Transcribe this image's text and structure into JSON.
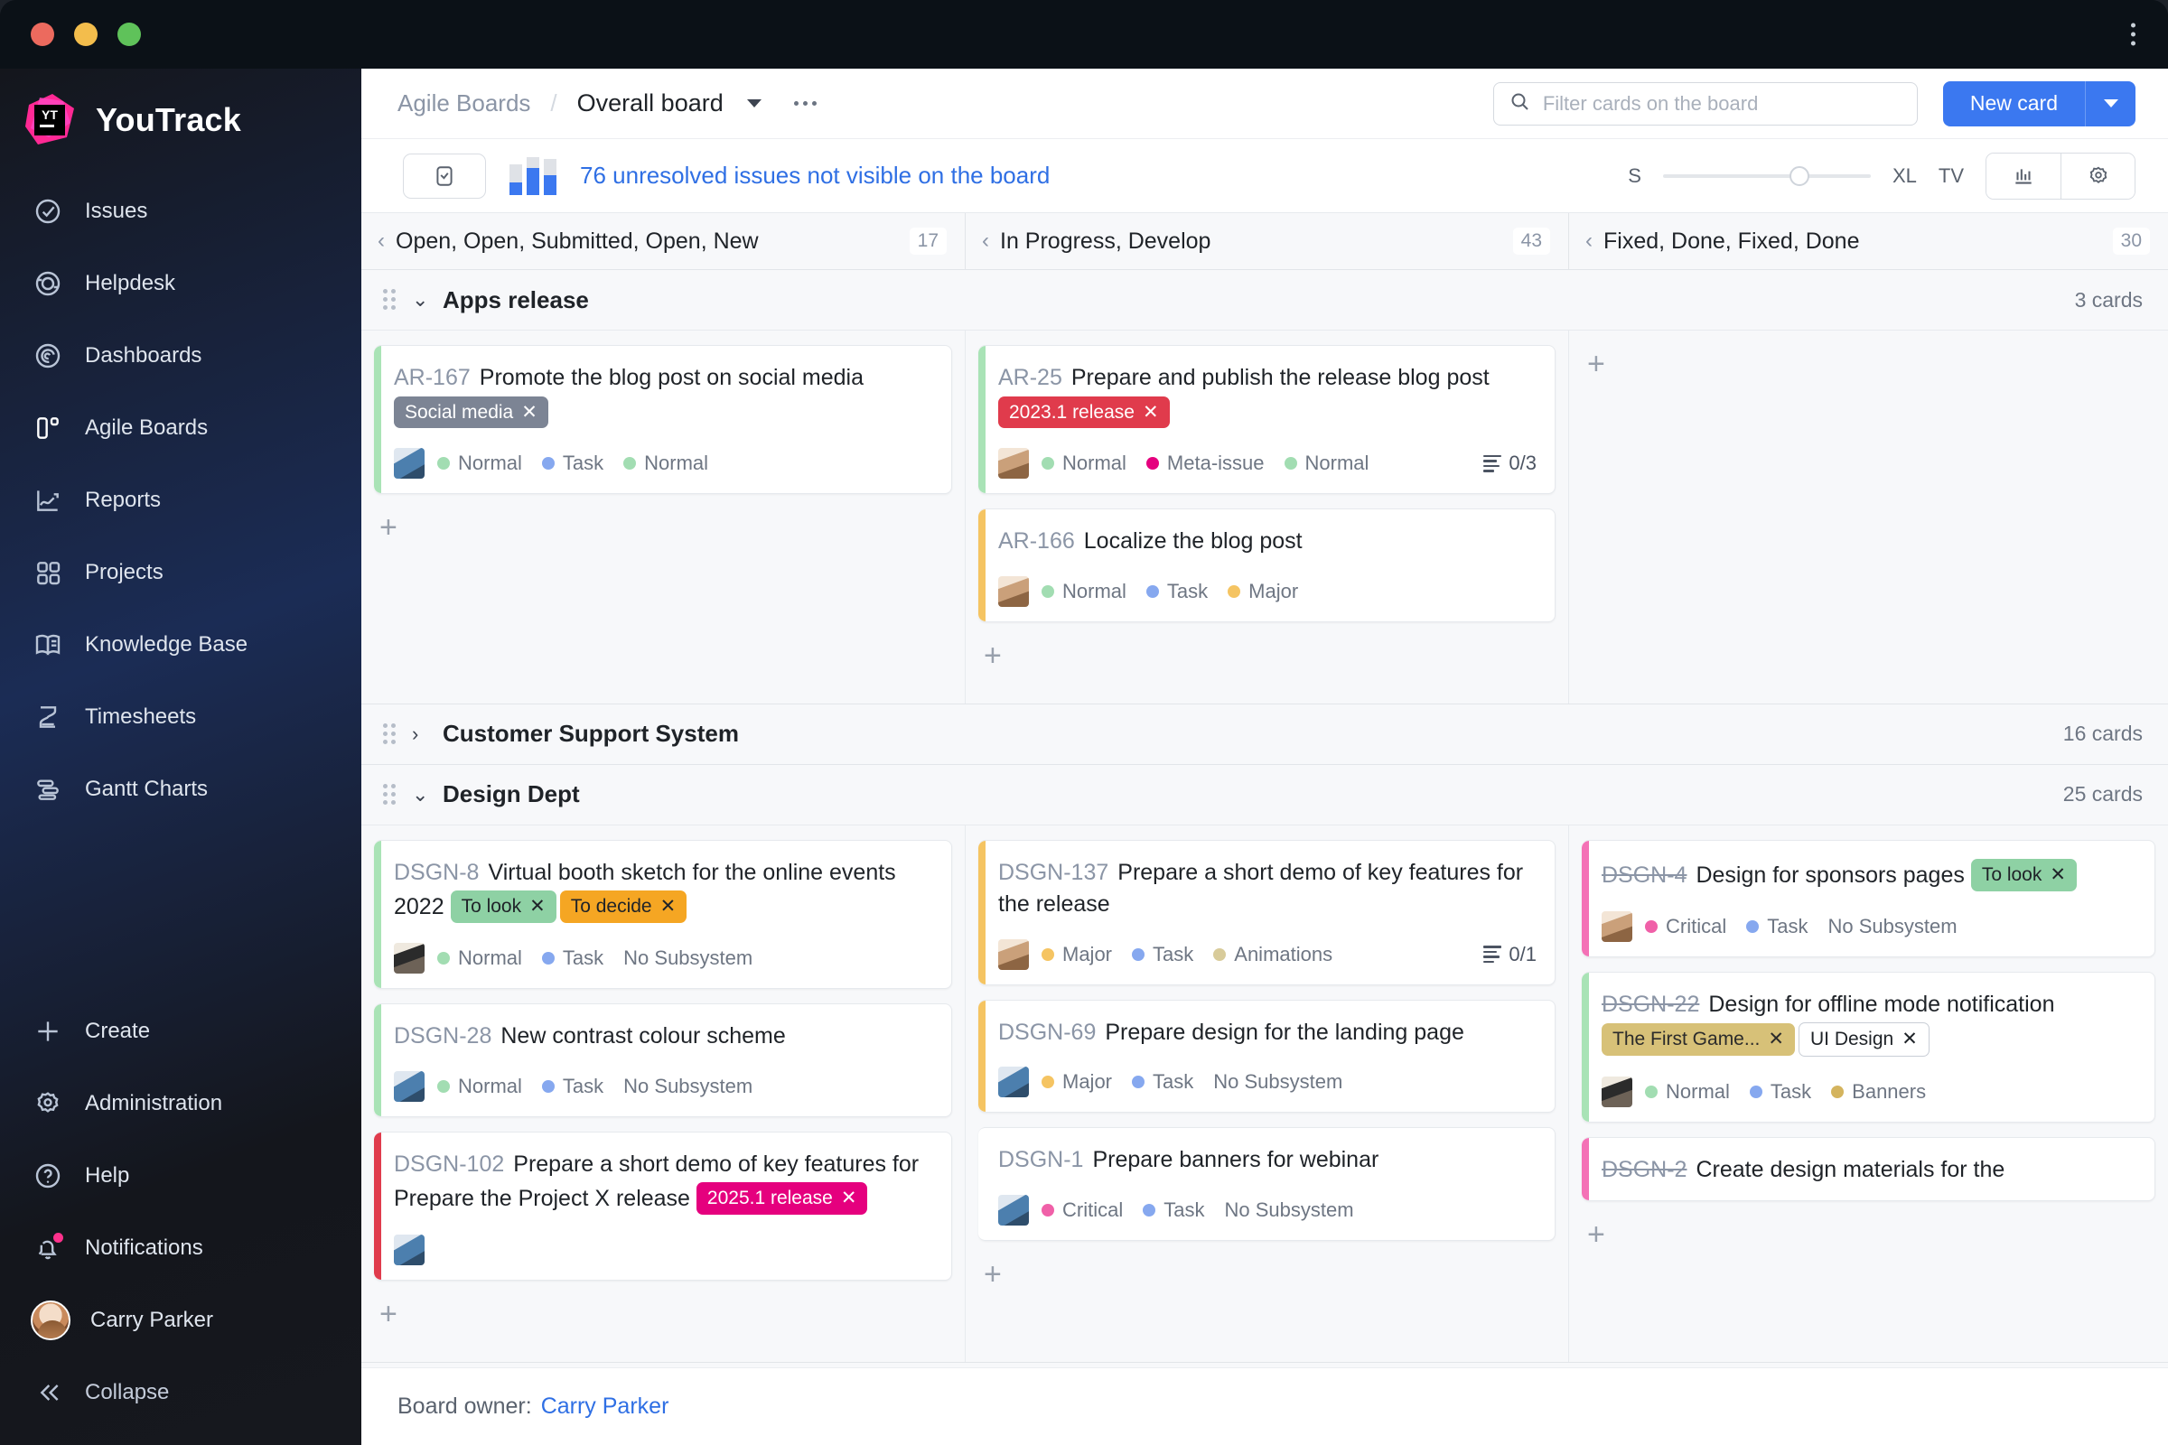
{
  "window": {
    "title": "YouTrack"
  },
  "sidebar": {
    "brand": "YouTrack",
    "items": [
      {
        "label": "Issues",
        "icon": "check-circle-icon"
      },
      {
        "label": "Helpdesk",
        "icon": "headset-icon"
      },
      {
        "label": "Dashboards",
        "icon": "spiral-icon"
      },
      {
        "label": "Agile Boards",
        "icon": "board-icon"
      },
      {
        "label": "Reports",
        "icon": "trend-up-icon"
      },
      {
        "label": "Projects",
        "icon": "grid-icon"
      },
      {
        "label": "Knowledge Base",
        "icon": "book-icon"
      },
      {
        "label": "Timesheets",
        "icon": "hourglass-icon"
      },
      {
        "label": "Gantt Charts",
        "icon": "gantt-icon"
      }
    ],
    "bottom": [
      {
        "label": "Create",
        "icon": "plus-icon"
      },
      {
        "label": "Administration",
        "icon": "gear-icon"
      },
      {
        "label": "Help",
        "icon": "question-circle-icon"
      },
      {
        "label": "Notifications",
        "icon": "bell-icon"
      }
    ],
    "user": "Carry Parker",
    "collapse": "Collapse"
  },
  "topbar": {
    "breadcrumb_root": "Agile Boards",
    "breadcrumb_separator": "/",
    "board_name": "Overall board",
    "search_placeholder": "Filter cards on the board",
    "search_value": "",
    "new_card_label": "New card"
  },
  "subbar": {
    "unresolved_text": "76 unresolved issues not visible on the board",
    "size_min": "S",
    "size_max": "XL",
    "tv_label": "TV"
  },
  "columns": [
    {
      "title": "Open, Open, Submitted, Open, New",
      "count": "17"
    },
    {
      "title": "In Progress, Develop",
      "count": "43"
    },
    {
      "title": "Fixed, Done, Fixed, Done",
      "count": "30"
    }
  ],
  "swimlanes": [
    {
      "title": "Apps release",
      "count": "3 cards",
      "expanded": true,
      "cells": [
        {
          "cards": [
            {
              "id": "AR-167",
              "resolved": false,
              "title": "Promote the blog post on social media",
              "stripe": "#a9e3b6",
              "tags": [
                {
                  "label": "Social media",
                  "bg": "#7c8494",
                  "fg": "#ffffff"
                }
              ],
              "avatar": "av-a",
              "chips": [
                {
                  "label": "Normal",
                  "color": "#a2ddb2"
                },
                {
                  "label": "Task",
                  "color": "#86a8ef"
                },
                {
                  "label": "Normal",
                  "color": "#a2ddb2"
                }
              ],
              "subtasks": ""
            }
          ]
        },
        {
          "cards": [
            {
              "id": "AR-25",
              "resolved": false,
              "title": "Prepare and publish the release blog post",
              "stripe": "#a9e3b6",
              "tags": [
                {
                  "label": "2023.1 release",
                  "bg": "#e03b4c",
                  "fg": "#ffffff"
                }
              ],
              "avatar": "av-b",
              "chips": [
                {
                  "label": "Normal",
                  "color": "#a2ddb2"
                },
                {
                  "label": "Meta-issue",
                  "color": "#e5007e"
                },
                {
                  "label": "Normal",
                  "color": "#a2ddb2"
                }
              ],
              "subtasks": "0/3"
            },
            {
              "id": "AR-166",
              "resolved": false,
              "title": "Localize the blog post",
              "stripe": "#f5c462",
              "tags": [],
              "avatar": "av-b",
              "chips": [
                {
                  "label": "Normal",
                  "color": "#a2ddb2"
                },
                {
                  "label": "Task",
                  "color": "#86a8ef"
                },
                {
                  "label": "Major",
                  "color": "#f5c462"
                }
              ],
              "subtasks": ""
            }
          ]
        },
        {
          "cards": []
        }
      ]
    },
    {
      "title": "Customer Support System",
      "count": "16 cards",
      "expanded": false,
      "cells": []
    },
    {
      "title": "Design Dept",
      "count": "25 cards",
      "expanded": true,
      "cells": [
        {
          "cards": [
            {
              "id": "DSGN-8",
              "resolved": false,
              "title": "Virtual booth sketch for the online events 2022",
              "stripe": "#a9e3b6",
              "tags": [
                {
                  "label": "To look",
                  "bg": "#8ed1a4",
                  "fg": "#1f2328"
                },
                {
                  "label": "To decide",
                  "bg": "#f5a623",
                  "fg": "#1f2328"
                }
              ],
              "avatar": "av-c",
              "chips": [
                {
                  "label": "Normal",
                  "color": "#a2ddb2"
                },
                {
                  "label": "Task",
                  "color": "#86a8ef"
                },
                {
                  "label": "No Subsystem",
                  "color": ""
                }
              ],
              "subtasks": ""
            },
            {
              "id": "DSGN-28",
              "resolved": false,
              "title": "New contrast colour scheme",
              "stripe": "#a9e3b6",
              "tags": [],
              "avatar": "av-a",
              "chips": [
                {
                  "label": "Normal",
                  "color": "#a2ddb2"
                },
                {
                  "label": "Task",
                  "color": "#86a8ef"
                },
                {
                  "label": "No Subsystem",
                  "color": ""
                }
              ],
              "subtasks": ""
            },
            {
              "id": "DSGN-102",
              "resolved": false,
              "title": "Prepare a short demo of key features for Prepare the Project X release",
              "stripe": "#e03b4c",
              "tags": [
                {
                  "label": "2025.1 release",
                  "bg": "#e5007e",
                  "fg": "#ffffff"
                }
              ],
              "avatar": "av-a",
              "chips": [],
              "subtasks": ""
            }
          ]
        },
        {
          "cards": [
            {
              "id": "DSGN-137",
              "resolved": false,
              "title": "Prepare a short demo of key features for the release",
              "stripe": "#f5c462",
              "tags": [],
              "avatar": "av-b",
              "chips": [
                {
                  "label": "Major",
                  "color": "#f5c462"
                },
                {
                  "label": "Task",
                  "color": "#86a8ef"
                },
                {
                  "label": "Animations",
                  "color": "#d8cb9a"
                }
              ],
              "subtasks": "0/1"
            },
            {
              "id": "DSGN-69",
              "resolved": false,
              "title": "Prepare design for the landing page",
              "stripe": "#f5c462",
              "tags": [],
              "avatar": "av-a",
              "chips": [
                {
                  "label": "Major",
                  "color": "#f5c462"
                },
                {
                  "label": "Task",
                  "color": "#86a8ef"
                },
                {
                  "label": "No Subsystem",
                  "color": ""
                }
              ],
              "subtasks": ""
            },
            {
              "id": "DSGN-1",
              "resolved": false,
              "title": "Prepare banners for webinar",
              "stripe": "#f munch",
              "tags": [],
              "avatar": "av-a",
              "chips": [
                {
                  "label": "Critical",
                  "color": "#f060a8"
                },
                {
                  "label": "Task",
                  "color": "#86a8ef"
                },
                {
                  "label": "No Subsystem",
                  "color": ""
                }
              ],
              "subtasks": ""
            }
          ]
        },
        {
          "cards": [
            {
              "id": "DSGN-4",
              "resolved": true,
              "title": "Design for sponsors pages",
              "stripe": "#f472b6",
              "tags": [
                {
                  "label": "To look",
                  "bg": "#8ed1a4",
                  "fg": "#1f2328"
                }
              ],
              "avatar": "av-b",
              "chips": [
                {
                  "label": "Critical",
                  "color": "#f060a8"
                },
                {
                  "label": "Task",
                  "color": "#86a8ef"
                },
                {
                  "label": "No Subsystem",
                  "color": ""
                }
              ],
              "subtasks": ""
            },
            {
              "id": "DSGN-22",
              "resolved": true,
              "title": "Design for offline mode notification",
              "stripe": "#a9e3b6",
              "tags": [
                {
                  "label": "The First Game...",
                  "bg": "#d7c178",
                  "fg": "#2b2b2b"
                },
                {
                  "label": "UI Design",
                  "bg": "#ffffff",
                  "fg": "#1f2328",
                  "outline": true
                }
              ],
              "avatar": "av-c",
              "chips": [
                {
                  "label": "Normal",
                  "color": "#a2ddb2"
                },
                {
                  "label": "Task",
                  "color": "#86a8ef"
                },
                {
                  "label": "Banners",
                  "color": "#d4b45e"
                }
              ],
              "subtasks": ""
            },
            {
              "id": "DSGN-2",
              "resolved": true,
              "title": "Create design materials for the",
              "stripe": "#f472b6",
              "tags": [],
              "avatar": "",
              "chips": [],
              "subtasks": ""
            }
          ]
        }
      ]
    }
  ],
  "footer": {
    "label": "Board owner:",
    "owner": "Carry Parker"
  }
}
